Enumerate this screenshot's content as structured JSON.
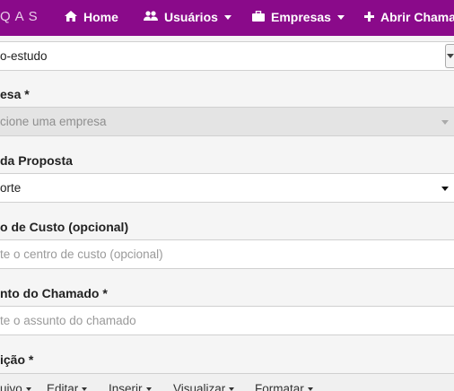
{
  "navbar": {
    "brand": "QAS",
    "items": [
      {
        "label": "Home",
        "icon": "home-icon"
      },
      {
        "label": "Usuários",
        "icon": "users-icon"
      },
      {
        "label": "Empresas",
        "icon": "briefcase-icon"
      },
      {
        "label": "Abrir Chamado",
        "icon": "plus-icon"
      }
    ],
    "colors": {
      "background": "#8a0a8a",
      "text": "#ffffff"
    }
  },
  "form": {
    "type_field": {
      "value": "o-estudo"
    },
    "empresa": {
      "label": "esa *",
      "placeholder": "cione uma empresa"
    },
    "proposta": {
      "label": "da Proposta",
      "value": "orte"
    },
    "centro_custo": {
      "label": "o de Custo (opcional)",
      "placeholder": "te o centro de custo (opcional)"
    },
    "assunto": {
      "label": "nto do Chamado *",
      "placeholder": "te o assunto do chamado"
    },
    "descricao": {
      "label": "ição *"
    }
  },
  "editor_menu": [
    {
      "label": "uivo"
    },
    {
      "label": "Editar"
    },
    {
      "label": "Inserir"
    },
    {
      "label": "Visualizar"
    },
    {
      "label": "Formatar"
    }
  ]
}
